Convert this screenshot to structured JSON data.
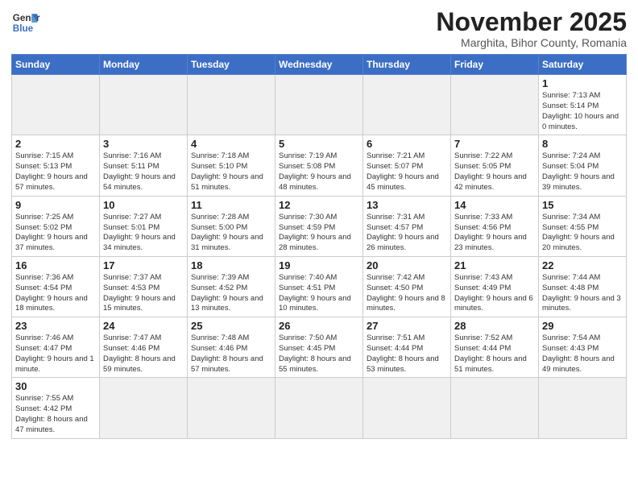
{
  "logo": {
    "line1": "General",
    "line2": "Blue"
  },
  "header": {
    "month": "November 2025",
    "location": "Marghita, Bihor County, Romania"
  },
  "weekdays": [
    "Sunday",
    "Monday",
    "Tuesday",
    "Wednesday",
    "Thursday",
    "Friday",
    "Saturday"
  ],
  "weeks": [
    [
      {
        "day": null
      },
      {
        "day": null
      },
      {
        "day": null
      },
      {
        "day": null
      },
      {
        "day": null
      },
      {
        "day": null
      },
      {
        "day": "1",
        "info": "Sunrise: 7:13 AM\nSunset: 5:14 PM\nDaylight: 10 hours\nand 0 minutes."
      }
    ],
    [
      {
        "day": "2",
        "info": "Sunrise: 7:15 AM\nSunset: 5:13 PM\nDaylight: 9 hours\nand 57 minutes."
      },
      {
        "day": "3",
        "info": "Sunrise: 7:16 AM\nSunset: 5:11 PM\nDaylight: 9 hours\nand 54 minutes."
      },
      {
        "day": "4",
        "info": "Sunrise: 7:18 AM\nSunset: 5:10 PM\nDaylight: 9 hours\nand 51 minutes."
      },
      {
        "day": "5",
        "info": "Sunrise: 7:19 AM\nSunset: 5:08 PM\nDaylight: 9 hours\nand 48 minutes."
      },
      {
        "day": "6",
        "info": "Sunrise: 7:21 AM\nSunset: 5:07 PM\nDaylight: 9 hours\nand 45 minutes."
      },
      {
        "day": "7",
        "info": "Sunrise: 7:22 AM\nSunset: 5:05 PM\nDaylight: 9 hours\nand 42 minutes."
      },
      {
        "day": "8",
        "info": "Sunrise: 7:24 AM\nSunset: 5:04 PM\nDaylight: 9 hours\nand 39 minutes."
      }
    ],
    [
      {
        "day": "9",
        "info": "Sunrise: 7:25 AM\nSunset: 5:02 PM\nDaylight: 9 hours\nand 37 minutes."
      },
      {
        "day": "10",
        "info": "Sunrise: 7:27 AM\nSunset: 5:01 PM\nDaylight: 9 hours\nand 34 minutes."
      },
      {
        "day": "11",
        "info": "Sunrise: 7:28 AM\nSunset: 5:00 PM\nDaylight: 9 hours\nand 31 minutes."
      },
      {
        "day": "12",
        "info": "Sunrise: 7:30 AM\nSunset: 4:59 PM\nDaylight: 9 hours\nand 28 minutes."
      },
      {
        "day": "13",
        "info": "Sunrise: 7:31 AM\nSunset: 4:57 PM\nDaylight: 9 hours\nand 26 minutes."
      },
      {
        "day": "14",
        "info": "Sunrise: 7:33 AM\nSunset: 4:56 PM\nDaylight: 9 hours\nand 23 minutes."
      },
      {
        "day": "15",
        "info": "Sunrise: 7:34 AM\nSunset: 4:55 PM\nDaylight: 9 hours\nand 20 minutes."
      }
    ],
    [
      {
        "day": "16",
        "info": "Sunrise: 7:36 AM\nSunset: 4:54 PM\nDaylight: 9 hours\nand 18 minutes."
      },
      {
        "day": "17",
        "info": "Sunrise: 7:37 AM\nSunset: 4:53 PM\nDaylight: 9 hours\nand 15 minutes."
      },
      {
        "day": "18",
        "info": "Sunrise: 7:39 AM\nSunset: 4:52 PM\nDaylight: 9 hours\nand 13 minutes."
      },
      {
        "day": "19",
        "info": "Sunrise: 7:40 AM\nSunset: 4:51 PM\nDaylight: 9 hours\nand 10 minutes."
      },
      {
        "day": "20",
        "info": "Sunrise: 7:42 AM\nSunset: 4:50 PM\nDaylight: 9 hours\nand 8 minutes."
      },
      {
        "day": "21",
        "info": "Sunrise: 7:43 AM\nSunset: 4:49 PM\nDaylight: 9 hours\nand 6 minutes."
      },
      {
        "day": "22",
        "info": "Sunrise: 7:44 AM\nSunset: 4:48 PM\nDaylight: 9 hours\nand 3 minutes."
      }
    ],
    [
      {
        "day": "23",
        "info": "Sunrise: 7:46 AM\nSunset: 4:47 PM\nDaylight: 9 hours\nand 1 minute."
      },
      {
        "day": "24",
        "info": "Sunrise: 7:47 AM\nSunset: 4:46 PM\nDaylight: 8 hours\nand 59 minutes."
      },
      {
        "day": "25",
        "info": "Sunrise: 7:48 AM\nSunset: 4:46 PM\nDaylight: 8 hours\nand 57 minutes."
      },
      {
        "day": "26",
        "info": "Sunrise: 7:50 AM\nSunset: 4:45 PM\nDaylight: 8 hours\nand 55 minutes."
      },
      {
        "day": "27",
        "info": "Sunrise: 7:51 AM\nSunset: 4:44 PM\nDaylight: 8 hours\nand 53 minutes."
      },
      {
        "day": "28",
        "info": "Sunrise: 7:52 AM\nSunset: 4:44 PM\nDaylight: 8 hours\nand 51 minutes."
      },
      {
        "day": "29",
        "info": "Sunrise: 7:54 AM\nSunset: 4:43 PM\nDaylight: 8 hours\nand 49 minutes."
      }
    ],
    [
      {
        "day": "30",
        "info": "Sunrise: 7:55 AM\nSunset: 4:42 PM\nDaylight: 8 hours\nand 47 minutes."
      },
      {
        "day": null
      },
      {
        "day": null
      },
      {
        "day": null
      },
      {
        "day": null
      },
      {
        "day": null
      },
      {
        "day": null
      }
    ]
  ]
}
